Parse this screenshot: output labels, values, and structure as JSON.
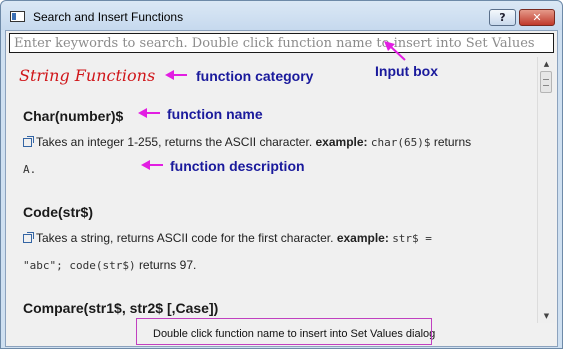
{
  "window": {
    "title": "Search and Insert Functions",
    "help_label": "?",
    "close_label": "✕"
  },
  "search": {
    "placeholder": "Enter keywords to search. Double click function name to insert into Set Values"
  },
  "content": {
    "category": "String Functions",
    "functions": [
      {
        "name": "Char(number)$",
        "desc_text": "Takes an integer 1-255, returns the ASCII character.",
        "example_label": "example:",
        "example_code": "char(65)$",
        "returns_word": "returns",
        "result": "A."
      },
      {
        "name": "Code(str$)",
        "desc_text": "Takes a string, returns ASCII code for the first character.",
        "example_label": "example:",
        "example_code_1": "str$ =",
        "example_code_2": "\"abc\"; code(str$)",
        "returns_word": "returns",
        "result": "97."
      },
      {
        "name": "Compare(str1$, str2$ [,Case])"
      }
    ]
  },
  "annotations": {
    "category": "function category",
    "input_box": "Input box",
    "name": "function name",
    "description": "function description"
  },
  "status": {
    "text": "Double click function name to insert into Set Values dialog"
  },
  "colors": {
    "category_red": "#d0161a",
    "annotation_blue": "#1a1a9c",
    "arrow_magenta": "#e21ee2"
  }
}
